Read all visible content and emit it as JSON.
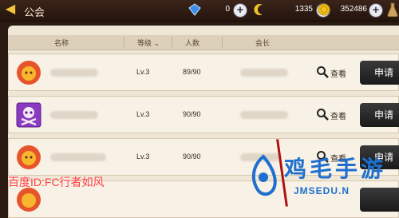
{
  "header": {
    "back_icon": "arrow-left-icon",
    "title": "公会"
  },
  "resources": [
    {
      "icon": "blue-gem-icon",
      "value": "0"
    },
    {
      "icon": "crescent-icon",
      "value": "1335"
    },
    {
      "icon": "gold-coin-icon",
      "value": "352486"
    }
  ],
  "table": {
    "columns": [
      "名称",
      "等级",
      "人数",
      "会长"
    ],
    "rows": [
      {
        "emblem": "orange-lion-emblem",
        "level": "Lv.3",
        "members": "89/90",
        "view_label": "查看",
        "apply_label": "申请"
      },
      {
        "emblem": "purple-skull-emblem",
        "level": "Lv.3",
        "members": "90/90",
        "view_label": "查看",
        "apply_label": "申请"
      },
      {
        "emblem": "orange-lion-emblem",
        "level": "Lv.3",
        "members": "90/90",
        "view_label": "查看",
        "apply_label": "申请"
      },
      {
        "emblem": "orange-lion-emblem",
        "level": "",
        "members": "",
        "view_label": "",
        "apply_label": ""
      }
    ]
  },
  "watermark": {
    "left": "百度ID:FC行者如风",
    "right_title": "鸡毛手游",
    "right_url": "JMSEDU.N"
  },
  "colors": {
    "panel": "#efe6d6",
    "row": "#f7f1e6",
    "apply_button": "#1f1f1f",
    "watermark_red": "#ff3b3b",
    "watermark_blue": "#1f6fcf"
  }
}
